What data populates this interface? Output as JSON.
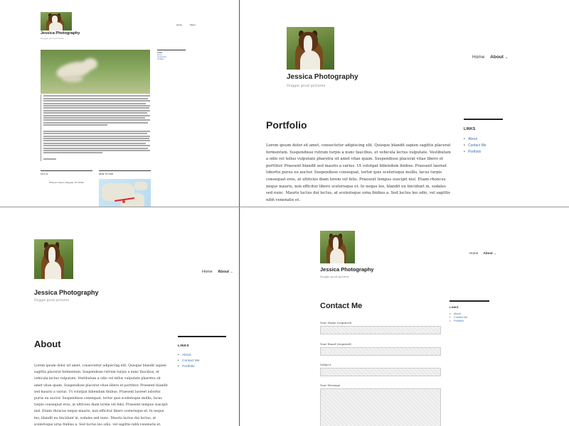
{
  "site": {
    "title": "Jessica Photography",
    "tagline": "Doggie good pictures",
    "nav_home": "Home",
    "nav_about": "About",
    "chevron": "⌄"
  },
  "widget": {
    "title": "LINKS",
    "links": [
      "About",
      "Contact Me",
      "Portfolio"
    ]
  },
  "panel1": {
    "footer_left_title": "Find Us",
    "footer_address": "95 Event Street, Aalsgaaj, XD 20440",
    "footer_right_title": "MINE TO FIND"
  },
  "panel2": {
    "heading": "Portfolio",
    "body": "Lorem ipsum dolor sit amet, consectetur adipiscing elit. Quisque blandit sapien sagittis placerat fermentum. Suspendisse rutrum turpis a nunc faucibus, et vehicula lectus vulputate. Vestibulum a odio vel tellus vulputate pharetra sit amet vitae quam. Suspendisse placerat vitae libero et porttitor. Praesent blandit sed mauris a varius. Ut volutpat bibendum finibus. Praesent laoreet lobortis purus eu auctor. Suspendisse consequat, tortor quis scelerisque mollis, lacus turpis consequat eros, at ultricies diam lorem vel felis. Praesent tempus suscipit nisl. Etiam rhoncus neque mauris, non efficitur libero scelerisque et. In neque leo, blandit eu tincidunt in, sodales sed nunc. Mauris luctus dui lectus, at scelerisque urna finibus a. Sed luctus leo odio, vel sagittis nibh venenatis et."
  },
  "panel3": {
    "heading": "About",
    "body": "Lorem ipsum dolor sit amet, consectetur adipiscing elit. Quisque blandit sapien sagittis placerat fermentum. Suspendisse rutrum turpis a nunc faucibus, et vehicula lectus vulputate. Vestibulum a odio vel tellus vulputate pharetra sit amet vitae quam. Suspendisse placerat vitae libero et porttitor. Praesent blandit sed mauris a varius. Ut volutpat bibendum finibus. Praesent laoreet lobortis purus eu auctor. Suspendisse consequat, tortor quis scelerisque mollis, lacus turpis consequat eros, at ultricies diam lorem vel felis. Praesent tempus suscipit nisl. Etiam rhoncus neque mauris, non efficitur libero scelerisque et. In neque leo, blandit eu tincidunt in, sodales sed nunc. Mauris luctus dui lectus, at scelerisque urna finibus a. Sed luctus leo odio, vel sagittis nibh venenatis et."
  },
  "panel4": {
    "heading": "Contact Me",
    "fields": [
      "Your Name (required)",
      "Your Email (required)",
      "Subject",
      "Your Message"
    ]
  },
  "colors": {
    "link": "#3d6fb0",
    "divider": "#555555"
  }
}
